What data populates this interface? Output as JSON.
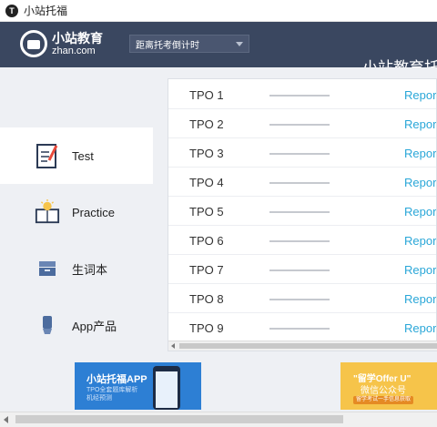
{
  "window": {
    "title": "小站托福"
  },
  "header": {
    "logo_cn": "小站教育",
    "logo_en": "zhan.com",
    "dropdown_label": "距离托考倒计时",
    "title": "小站教育托"
  },
  "sidebar": {
    "items": [
      {
        "label": "Test",
        "icon": "test-checklist-icon",
        "active": true
      },
      {
        "label": "Practice",
        "icon": "lightbulb-book-icon",
        "active": false
      },
      {
        "label": "生词本",
        "icon": "word-box-icon",
        "active": false
      },
      {
        "label": "App产品",
        "icon": "app-badge-icon",
        "active": false
      }
    ]
  },
  "tpo_list": {
    "rows": [
      {
        "name": "TPO 1",
        "action": "Report"
      },
      {
        "name": "TPO 2",
        "action": "Report"
      },
      {
        "name": "TPO 3",
        "action": "Report"
      },
      {
        "name": "TPO 4",
        "action": "Report"
      },
      {
        "name": "TPO 5",
        "action": "Report"
      },
      {
        "name": "TPO 6",
        "action": "Report"
      },
      {
        "name": "TPO 7",
        "action": "Report"
      },
      {
        "name": "TPO 8",
        "action": "Report"
      },
      {
        "name": "TPO 9",
        "action": "Report"
      }
    ]
  },
  "banners": {
    "left": {
      "title": "小站托福APP",
      "line1": "TPO全套题库解析",
      "line2": "机经预测"
    },
    "right": {
      "title": "\"留学Offer U\"",
      "line2": "微信公众号",
      "pill": "留学考试一手信息获取"
    }
  },
  "colors": {
    "header_bg": "#3a4760",
    "link": "#2aa7d8",
    "banner_blue": "#2d7fd4",
    "banner_yellow": "#f6c44a"
  }
}
